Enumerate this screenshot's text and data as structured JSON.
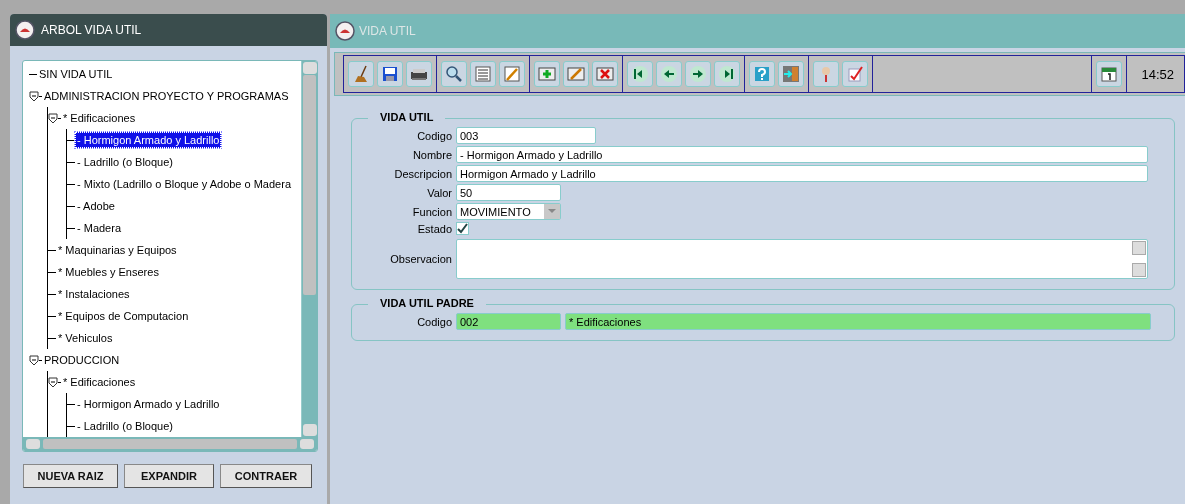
{
  "left_panel": {
    "title": "ARBOL VIDA UTIL",
    "tree": [
      {
        "label": "SIN VIDA UTIL",
        "selected": false
      },
      {
        "label": "ADMINISTRACION PROYECTO Y PROGRAMAS",
        "selected": false,
        "expanded": true,
        "children": [
          {
            "label": "* Edificaciones",
            "selected": false,
            "expanded": true,
            "children": [
              {
                "label": "- Hormigon Armado y Ladrillo",
                "selected": true
              },
              {
                "label": "- Ladrillo (o Bloque)",
                "selected": false
              },
              {
                "label": "- Mixto (Ladrillo o Bloque y Adobe o Madera",
                "selected": false
              },
              {
                "label": "- Adobe",
                "selected": false
              },
              {
                "label": "- Madera",
                "selected": false
              }
            ]
          },
          {
            "label": "* Maquinarias y Equipos",
            "selected": false
          },
          {
            "label": "* Muebles y Enseres",
            "selected": false
          },
          {
            "label": "* Instalaciones",
            "selected": false
          },
          {
            "label": "* Equipos de Computacion",
            "selected": false
          },
          {
            "label": "* Vehiculos",
            "selected": false
          }
        ]
      },
      {
        "label": "PRODUCCION",
        "selected": false,
        "expanded": true,
        "children": [
          {
            "label": "* Edificaciones",
            "selected": false,
            "expanded": true,
            "children": [
              {
                "label": "- Hormigon Armado y Ladrillo",
                "selected": false
              },
              {
                "label": "- Ladrillo (o Bloque)",
                "selected": false
              }
            ]
          }
        ]
      }
    ],
    "buttons": [
      "NUEVA RAIZ",
      "EXPANDIR",
      "CONTRAER"
    ]
  },
  "right_panel": {
    "title": "VIDA UTIL",
    "toolbar": {
      "time": "14:52"
    },
    "sections": [
      {
        "title": "VIDA UTIL",
        "fields": [
          {
            "label": "Codigo",
            "kind": "code",
            "value": "003"
          },
          {
            "label": "Nombre",
            "kind": "text",
            "value": "- Hormigon Armado y Ladrillo"
          },
          {
            "label": "Descripcion",
            "kind": "text",
            "value": "Hormigon Armado y Ladrillo"
          },
          {
            "label": "Valor",
            "kind": "number",
            "value": "50"
          },
          {
            "label": "Funcion",
            "kind": "select",
            "value": "MOVIMIENTO"
          },
          {
            "label": "Estado",
            "kind": "checkbox",
            "checked": true
          },
          {
            "label": "Observacion",
            "kind": "textarea"
          }
        ]
      },
      {
        "title": "VIDA UTIL PADRE",
        "fields": [
          {
            "label": "Codigo",
            "kind": "lookup",
            "values": [
              "002",
              "* Edificaciones"
            ]
          }
        ]
      }
    ]
  }
}
